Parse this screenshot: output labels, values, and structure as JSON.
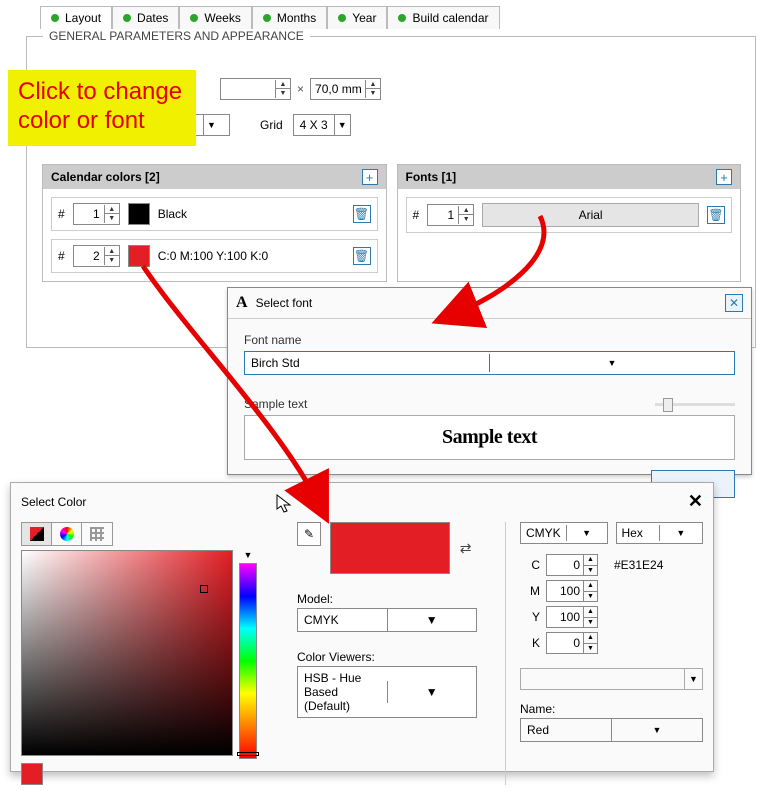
{
  "tabs": {
    "t0": "Layout",
    "t1": "Dates",
    "t2": "Weeks",
    "t3": "Months",
    "t4": "Year",
    "t5": "Build calendar"
  },
  "group_title": "GENERAL PARAMETERS AND APPEARANCE",
  "callout": {
    "l1": "Click to change",
    "l2": "color or font"
  },
  "size": {
    "w_val": "",
    "h": "70,0 mm",
    "unit": "×"
  },
  "grid": {
    "label": "Grid",
    "val": "4 X 3"
  },
  "colors_panel": {
    "title": "Calendar colors  [2]"
  },
  "fonts_panel": {
    "title": "Fonts  [1]"
  },
  "rows": {
    "hash": "#",
    "c1_num": "1",
    "c1_name": "Black",
    "c2_num": "2",
    "c2_name": "C:0 M:100 Y:100 K:0",
    "f1_num": "1",
    "f1_name": "Arial"
  },
  "font_dialog": {
    "title": "Select font",
    "name_label": "Font name",
    "fontname": "Birch Std",
    "sample_label": "Sample text",
    "sample": "Sample text"
  },
  "color_dialog": {
    "title": "Select Color",
    "model_label": "Model:",
    "model": "CMYK",
    "viewers_label": "Color Viewers:",
    "viewer": "HSB - Hue Based (Default)",
    "left_sel": "CMYK",
    "right_sel": "Hex",
    "hex": "#E31E24",
    "c_lbl": "C",
    "c": "0",
    "m_lbl": "M",
    "m": "100",
    "y_lbl": "Y",
    "y": "100",
    "k_lbl": "K",
    "k": "0",
    "name_label": "Name:",
    "name": "Red"
  }
}
